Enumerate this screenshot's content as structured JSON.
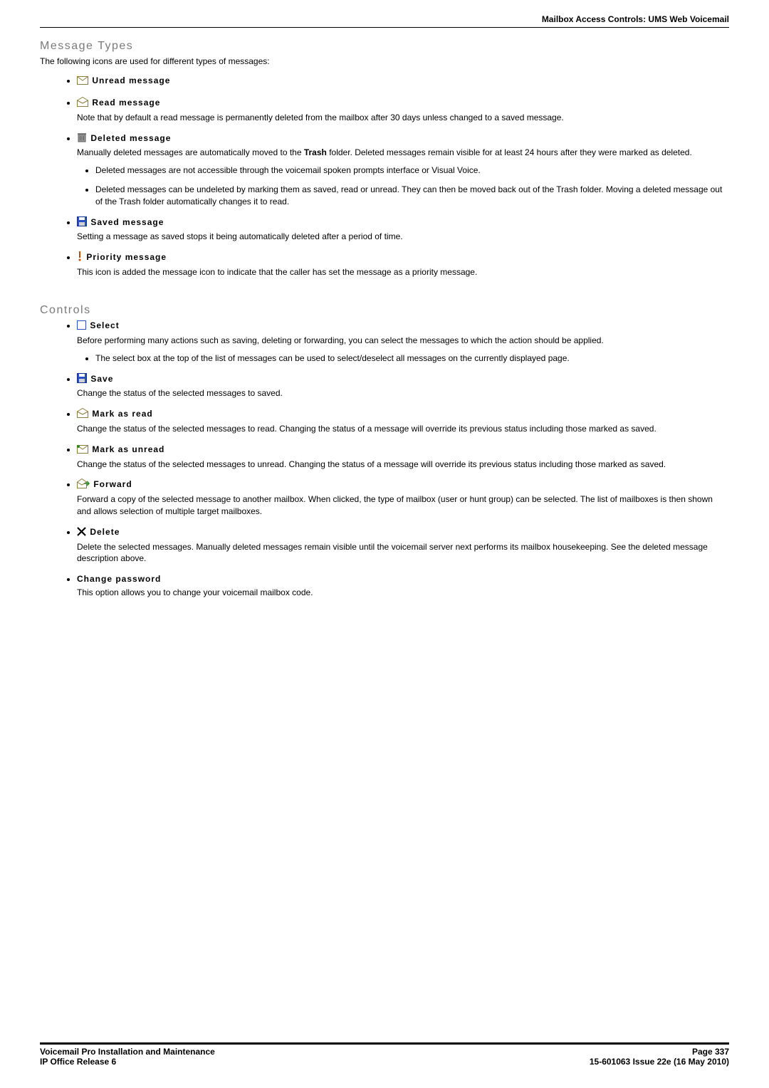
{
  "header": {
    "breadcrumb": "Mailbox Access Controls: UMS Web Voicemail"
  },
  "sections": {
    "msgtypes": {
      "title": "Message Types",
      "intro": "The following icons are used for different types of messages:",
      "items": {
        "unread": {
          "label": "Unread message"
        },
        "read": {
          "label": "Read message",
          "desc": "Note that by default a read message is permanently deleted from the mailbox after 30 days unless changed to a saved message."
        },
        "deleted": {
          "label": "Deleted message",
          "desc_a": "Manually deleted messages are automatically moved to the ",
          "desc_trash": "Trash",
          "desc_b": " folder. Deleted messages remain visible for at least 24 hours after they were marked as deleted.",
          "sub1": "Deleted messages are not accessible through the voicemail spoken prompts interface or Visual Voice.",
          "sub2": "Deleted messages can be undeleted by marking them as saved, read or unread. They can then be moved back out of the Trash folder. Moving a deleted message out of the Trash folder automatically changes it to read."
        },
        "saved": {
          "label": "Saved message",
          "desc": "Setting a message as saved stops it being automatically deleted after a period of time."
        },
        "priority": {
          "label": "Priority message",
          "desc": "This icon is added the message icon to indicate that the caller has set the message as a priority message."
        }
      }
    },
    "controls": {
      "title": "Controls",
      "items": {
        "select": {
          "label": "Select",
          "desc": "Before performing many actions such as saving, deleting or forwarding, you can select the messages to which the action should be applied.",
          "sub1": "The select box at the top of the list of messages can be used to select/deselect all messages on the currently displayed page."
        },
        "save": {
          "label": "Save",
          "desc": "Change the status of the selected messages to saved."
        },
        "markread": {
          "label": "Mark as read",
          "desc": "Change the status of the selected messages to read. Changing the status of a message will override its previous status including those marked as saved."
        },
        "markunread": {
          "label": "Mark as unread",
          "desc": "Change the status of the selected messages to unread. Changing the status of a message will override its previous status including those marked as saved."
        },
        "forward": {
          "label": "Forward",
          "desc": "Forward a copy of the selected message to another mailbox. When clicked, the type of mailbox (user or hunt group) can be selected. The list of mailboxes is then shown and allows selection of multiple target mailboxes."
        },
        "delete": {
          "label": "Delete",
          "desc": "Delete the selected messages. Manually deleted messages remain visible until the voicemail server next performs its mailbox housekeeping. See the deleted message description above."
        },
        "changepw": {
          "label": "Change password",
          "desc": "This option allows you to change your voicemail mailbox code."
        }
      }
    }
  },
  "footer": {
    "left1": "Voicemail Pro Installation and Maintenance",
    "right1": "Page 337",
    "left2": "IP Office Release 6",
    "right2": "15-601063 Issue 22e (16 May 2010)"
  },
  "icons": {
    "unread_stroke": "#8a7b3a",
    "read_stroke": "#8a7b3a",
    "deleted_fill": "#6a6a6a",
    "saved_blue": "#2a4fbf",
    "priority_color": "#c14a00",
    "checkbox_stroke": "#2a4fbf",
    "delete_x": "#000",
    "forward_arrow": "#2a8a2a"
  }
}
